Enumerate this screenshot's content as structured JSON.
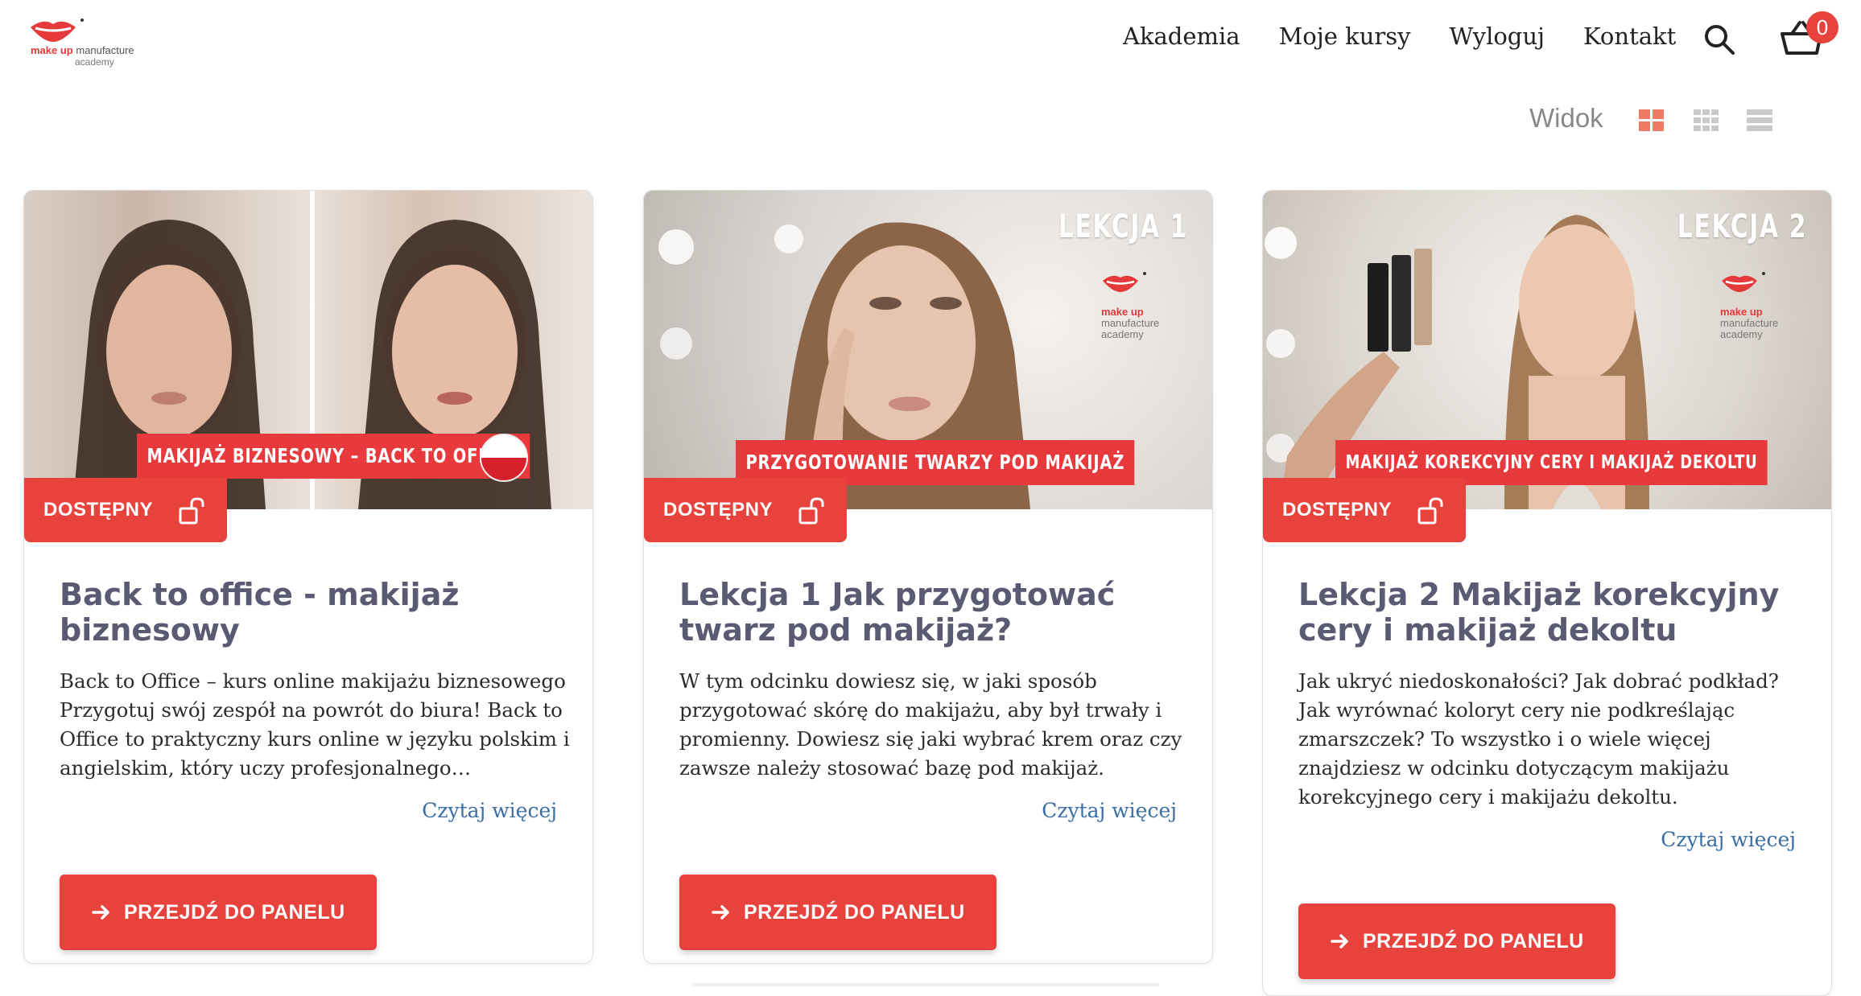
{
  "header": {
    "logo_word1": "make up",
    "logo_word2": "manufacture",
    "logo_word3": "academy",
    "nav": [
      "Akademia",
      "Moje kursy",
      "Wyloguj",
      "Kontakt"
    ],
    "cart_count": "0",
    "icons": [
      "search-icon",
      "basket-icon"
    ]
  },
  "view": {
    "label": "Widok",
    "options": [
      "grid-2-icon",
      "grid-3-icon",
      "list-icon"
    ],
    "active": "grid-2-icon"
  },
  "colors": {
    "accent": "#e8423d",
    "title": "#5a5a72",
    "link": "#3a6ea5"
  },
  "cards": [
    {
      "caption": "MAKIJAŻ BIZNESOWY – BACK TO OFFICE",
      "badge": "DOSTĘPNY",
      "title": "Back to office - makijaż biznesowy",
      "description": " Back to Office – kurs online makijażu biznesowego Przygotuj swój zespół na powrót do biura! Back to Office to praktyczny kurs online w języku polskim i angielskim, który uczy profesjonalnego…",
      "read_more": "Czytaj więcej",
      "button": "PRZEJDŹ DO PANELU"
    },
    {
      "lesson_tag": "LEKCJA 1",
      "logo_word1": "make up",
      "logo_word2": "manufacture",
      "logo_word3": "academy",
      "caption": "PRZYGOTOWANIE TWARZY POD MAKIJAŻ",
      "badge": "DOSTĘPNY",
      "title": "Lekcja 1 Jak przygotować twarz pod makijaż?",
      "description": "W tym odcinku dowiesz się, w jaki sposób przygotować skórę do makijażu, aby był trwały i promienny. Dowiesz się jaki wybrać krem oraz czy zawsze należy stosować bazę pod makijaż.",
      "read_more": "Czytaj więcej",
      "button": "PRZEJDŹ DO PANELU"
    },
    {
      "lesson_tag": "LEKCJA 2",
      "logo_word1": "make up",
      "logo_word2": "manufacture",
      "logo_word3": "academy",
      "caption": "MAKIJAŻ KOREKCYJNY CERY I MAKIJAŻ DEKOLTU",
      "badge": "DOSTĘPNY",
      "title": "Lekcja 2 Makijaż korekcyjny cery i makijaż dekoltu",
      "description": "Jak ukryć niedoskonałości? Jak dobrać podkład? Jak wyrównać koloryt cery nie podkreślając zmarszczek? To wszystko i o wiele więcej znajdziesz w odcinku dotyczącym makijażu korekcyjnego cery i makijażu dekoltu.",
      "read_more": "Czytaj więcej",
      "button": "PRZEJDŹ DO PANELU"
    }
  ]
}
